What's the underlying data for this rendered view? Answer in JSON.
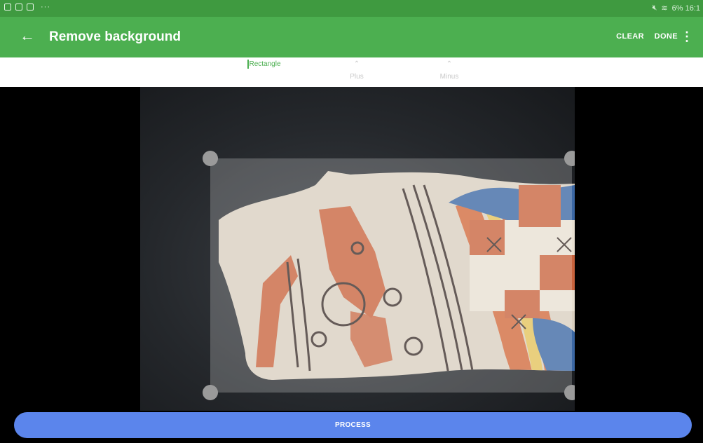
{
  "status_bar": {
    "more_dots": "···",
    "right_text": "6% 16:1"
  },
  "app_bar": {
    "title": "Remove background",
    "back_icon": "arrow-back-icon",
    "clear_label": "CLEAR",
    "done_label": "DONE",
    "more_icon": "more-vert-icon",
    "color": "#4caf50"
  },
  "tools": {
    "rectangle_label": "Rectangle",
    "plus_label": "Plus",
    "minus_label": "Minus",
    "active": "Rectangle",
    "active_color": "#4caf50"
  },
  "canvas": {
    "image": "ceramic sherd photo"
  },
  "process_button": {
    "label": "PROCESS",
    "color": "#5b85ec"
  }
}
